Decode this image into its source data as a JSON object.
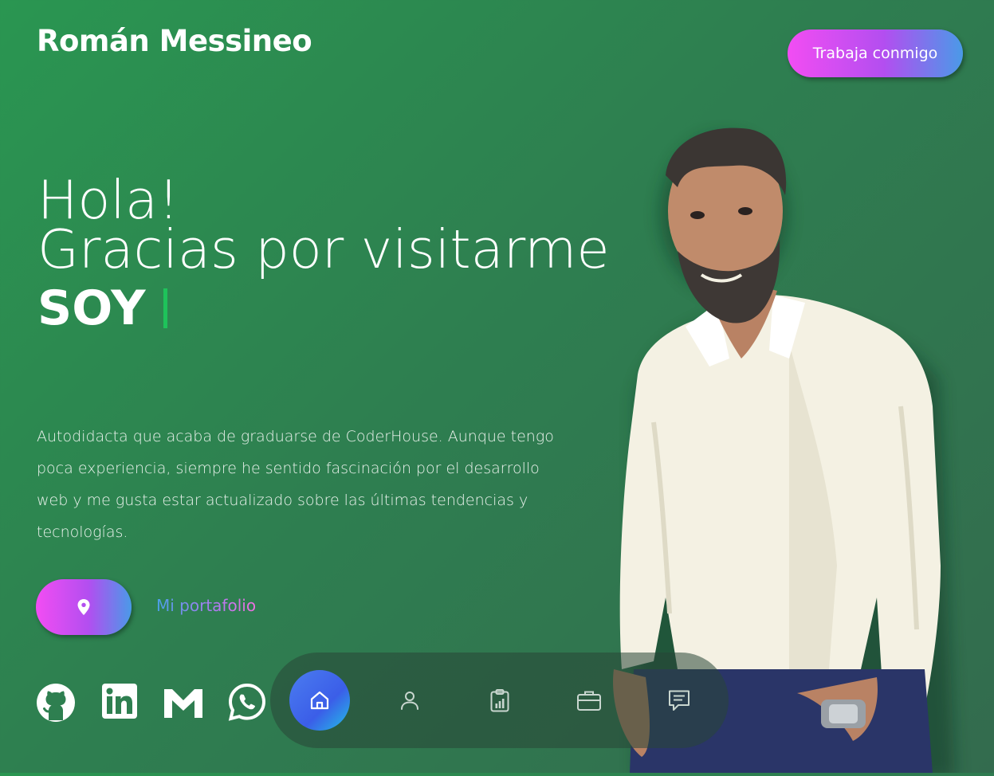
{
  "header": {
    "brand": "Román Messineo",
    "cta_label": "Trabaja conmigo"
  },
  "hero": {
    "line1": "Hola!",
    "line2": "Gracias por visitarme",
    "soy": "SOY"
  },
  "bio": "Autodidacta que acaba de graduarse de CoderHouse. Aunque tengo poca experiencia, siempre he sentido fascinación por el desarrollo web y me gusta estar actualizado sobre las últimas tendencias y tecnologías.",
  "actions": {
    "location_icon": "map-pin-icon",
    "portfolio_label": "Mi portafolio"
  },
  "social": [
    {
      "icon": "github-icon"
    },
    {
      "icon": "linkedin-icon"
    },
    {
      "icon": "gmail-icon"
    },
    {
      "icon": "whatsapp-icon"
    }
  ],
  "dock": [
    {
      "icon": "home-icon",
      "active": true
    },
    {
      "icon": "user-icon",
      "active": false
    },
    {
      "icon": "clipboard-chart-icon",
      "active": false
    },
    {
      "icon": "briefcase-icon",
      "active": false
    },
    {
      "icon": "message-icon",
      "active": false
    }
  ],
  "colors": {
    "background_start": "#2a9651",
    "background_end": "#336b4e",
    "accent_pink": "#f24df3",
    "accent_blue": "#4a9ae8",
    "cursor_green": "#1ec35a"
  }
}
